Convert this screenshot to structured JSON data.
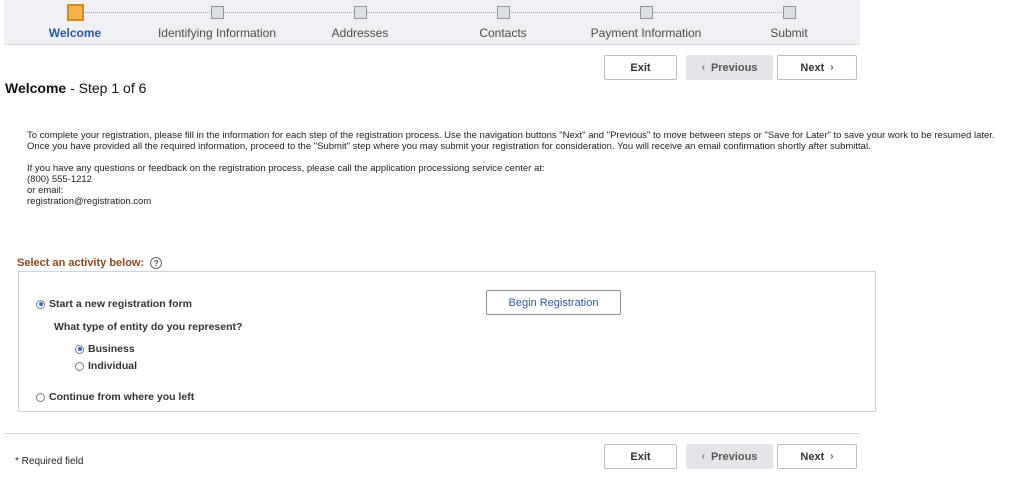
{
  "steps": [
    {
      "label": "Welcome",
      "active": true
    },
    {
      "label": "Identifying Information",
      "active": false
    },
    {
      "label": "Addresses",
      "active": false
    },
    {
      "label": "Contacts",
      "active": false
    },
    {
      "label": "Payment Information",
      "active": false
    },
    {
      "label": "Submit",
      "active": false
    }
  ],
  "nav": {
    "exit_label": "Exit",
    "previous_label": "Previous",
    "next_label": "Next",
    "prev_icon": "‹",
    "next_icon": "›"
  },
  "page": {
    "title": "Welcome",
    "step_text": "Step 1 of 6"
  },
  "intro": {
    "paragraph1": "To complete your registration, please fill in the information for each step of the registration process.  Use the navigation buttons \"Next\" and \"Previous\" to move between steps or \"Save for Later\" to save your work to be resumed later.  Once you have provided all the required information, proceed to the \"Submit\" step where you may submit your registration for consideration.  You will receive an email confirmation shortly after submittal.",
    "contact_line": "If you have any questions or feedback on the registration process, please call the application processiong service center at:",
    "phone": "(800) 555-1212",
    "or_email": "or email:",
    "email": "registration@registration.com"
  },
  "activity": {
    "label": "Select an activity below:",
    "help_icon": "?",
    "option_new": "Start a new registration form",
    "option_new_selected": true,
    "begin_button": "Begin Registration",
    "entity_question": "What type of entity do you represent?",
    "entity_business": "Business",
    "entity_business_selected": true,
    "entity_individual": "Individual",
    "entity_individual_selected": false,
    "option_continue": "Continue from where you left",
    "option_continue_selected": false
  },
  "footer": {
    "required_note": "* Required field"
  },
  "colors": {
    "accent_blue": "#2d5a9a",
    "active_step": "#f6b24a",
    "section_label": "#8a4a1c"
  }
}
